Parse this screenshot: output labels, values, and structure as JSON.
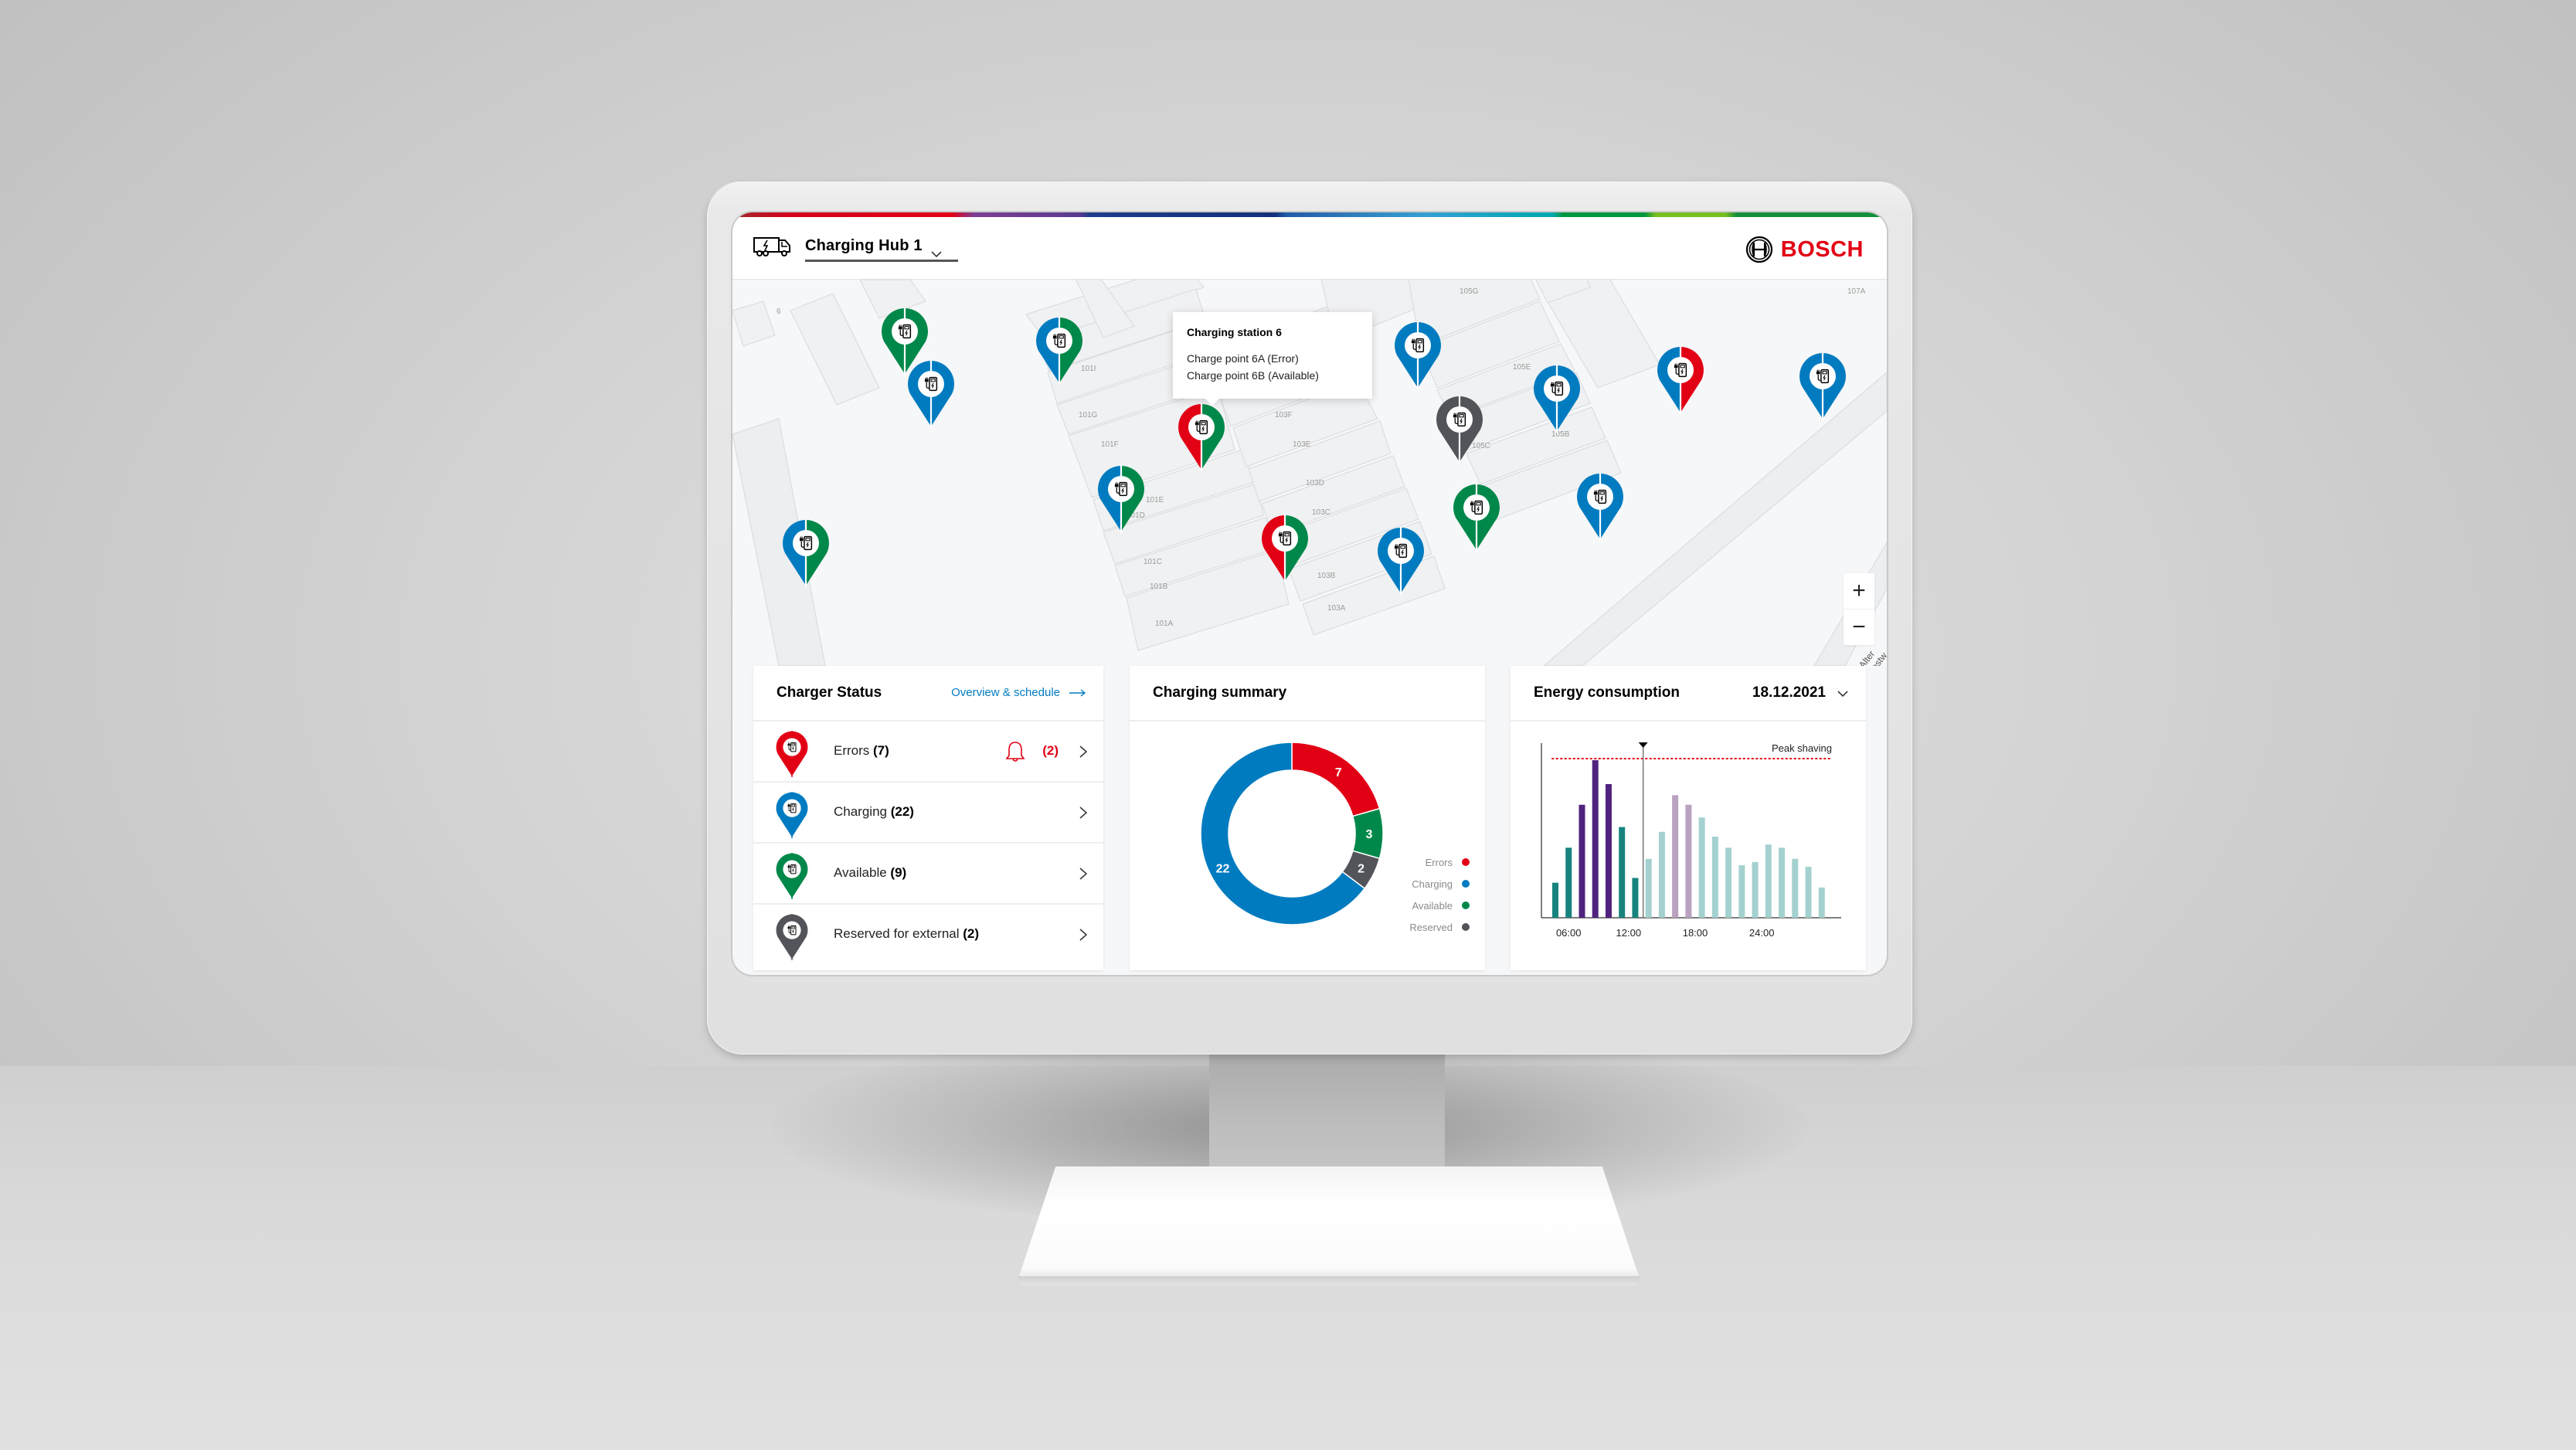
{
  "header": {
    "hub_icon": "truck-charging-icon",
    "hub_name": "Charging Hub 1",
    "hub_dropdown_icon": "chevron-down-icon",
    "brand_logo_icon": "bosch-armature-icon",
    "brand_name": "BOSCH"
  },
  "map": {
    "building_labels": [
      "6",
      "101I",
      "101G",
      "101F",
      "101E",
      "101D",
      "101C",
      "101B",
      "101A",
      "103F",
      "103E",
      "103D",
      "103C",
      "103B",
      "103A",
      "105G",
      "105E",
      "105C",
      "105B",
      "107A"
    ],
    "street_label": "Alter Postw",
    "pins": [
      {
        "name": "station-pin",
        "left": "available",
        "right": "available"
      },
      {
        "name": "station-pin",
        "left": "charging",
        "right": "charging"
      },
      {
        "name": "station-pin",
        "left": "charging",
        "right": "available"
      },
      {
        "name": "station-pin",
        "left": "error",
        "right": "available",
        "selected": true
      },
      {
        "name": "station-pin",
        "left": "charging",
        "right": "available"
      },
      {
        "name": "station-pin",
        "left": "charging",
        "right": "available"
      },
      {
        "name": "station-pin",
        "left": "error",
        "right": "available"
      },
      {
        "name": "station-pin",
        "left": "charging",
        "right": "charging"
      },
      {
        "name": "station-pin",
        "left": "reserved",
        "right": "reserved"
      },
      {
        "name": "station-pin",
        "left": "charging",
        "right": "charging"
      },
      {
        "name": "station-pin",
        "left": "available",
        "right": "available"
      },
      {
        "name": "station-pin",
        "left": "charging",
        "right": "charging"
      },
      {
        "name": "station-pin",
        "left": "charging",
        "right": "error"
      },
      {
        "name": "station-pin",
        "left": "charging",
        "right": "charging"
      },
      {
        "name": "station-pin",
        "left": "charging",
        "right": "charging"
      }
    ],
    "tooltip": {
      "title": "Charging station 6",
      "lines": [
        "Charge point 6A (Error)",
        "Charge point 6B (Available)"
      ]
    },
    "zoom_in_label": "+",
    "zoom_out_label": "−"
  },
  "status_colors": {
    "error": "#e20015",
    "charging": "#007bc0",
    "available": "#00884a",
    "reserved": "#525459"
  },
  "charger_status": {
    "title": "Charger Status",
    "link_label": "Overview & schedule",
    "rows": [
      {
        "status": "error",
        "label": "Errors",
        "count": "(7)",
        "alert_count": "(2)"
      },
      {
        "status": "charging",
        "label": "Charging",
        "count": "(22)"
      },
      {
        "status": "available",
        "label": "Available",
        "count": "(9)"
      },
      {
        "status": "reserved",
        "label": "Reserved for external",
        "count": "(2)"
      }
    ]
  },
  "charging_summary": {
    "title": "Charging summary"
  },
  "energy_consumption": {
    "title": "Energy consumption",
    "date": "18.12.2021"
  },
  "chart_data": [
    {
      "type": "pie",
      "title": "Charging summary",
      "variant": "donut",
      "categories": [
        "Errors",
        "Available",
        "Reserved",
        "Charging"
      ],
      "values": [
        7,
        3,
        2,
        22
      ],
      "colors": [
        "#e20015",
        "#00884a",
        "#525459",
        "#007bc0"
      ],
      "legend": [
        "Errors",
        "Charging",
        "Available",
        "Reserved"
      ],
      "legend_colors": [
        "#e20015",
        "#007bc0",
        "#00884a",
        "#525459"
      ],
      "legend_position": "bottom-right"
    },
    {
      "type": "bar",
      "title": "Energy consumption",
      "xlabel": "",
      "ylabel": "",
      "x_tick_labels": [
        "06:00",
        "12:00",
        "18:00",
        "24:00"
      ],
      "x_tick_bar_index": [
        1,
        5.5,
        10.5,
        15.5
      ],
      "values": [
        0.22,
        0.44,
        0.71,
        0.99,
        0.84,
        0.57,
        0.25,
        0.37,
        0.54,
        0.77,
        0.71,
        0.63,
        0.51,
        0.44,
        0.33,
        0.35,
        0.46,
        0.44,
        0.37,
        0.32,
        0.19
      ],
      "bar_categories": [
        "past",
        "past",
        "past-high",
        "past-high",
        "past-high",
        "past",
        "past",
        "forecast",
        "forecast",
        "forecast-high",
        "forecast-high",
        "forecast",
        "forecast",
        "forecast",
        "forecast",
        "forecast",
        "forecast",
        "forecast",
        "forecast",
        "forecast",
        "forecast"
      ],
      "category_colors": {
        "past": "#18837e",
        "past-high": "#50237f",
        "forecast": "#a4d1cf",
        "forecast-high": "#b9a1c0"
      },
      "ylim": [
        0,
        1
      ],
      "reference_line": {
        "label": "Peak shaving",
        "value": 1.0,
        "color": "#e20015",
        "style": "dotted"
      },
      "now_marker_after_bar": 6,
      "grid": false
    }
  ]
}
